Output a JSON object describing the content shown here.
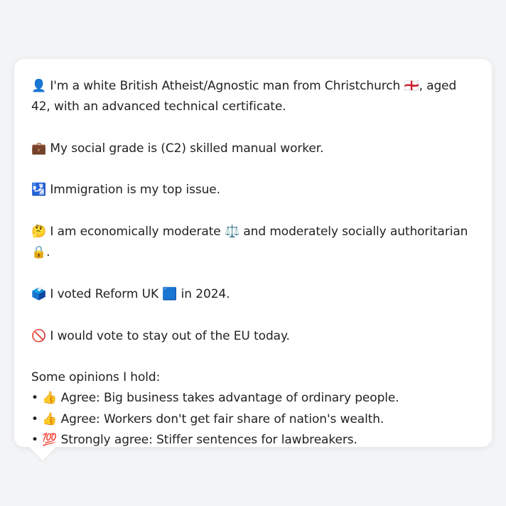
{
  "profile": {
    "identity": "👤 I'm a white British Atheist/Agnostic man from Christchurch 🏴󠁧󠁢󠁥󠁮󠁧󠁿, aged 42, with an advanced technical certificate.",
    "social_grade": "💼 My social grade is (C2) skilled manual worker.",
    "top_issue": "🛂 Immigration is my top issue.",
    "political_position": "🤔 I am economically moderate ⚖️ and moderately socially authoritarian 🔒.",
    "vote_2024": "🗳️ I voted Reform UK 🟦 in 2024.",
    "eu_vote": "🚫 I would vote to stay out of the EU today."
  },
  "opinions": {
    "title": "Some opinions I hold:",
    "items": [
      "• 👍 Agree: Big business takes advantage of ordinary people.",
      "• 👍 Agree: Workers don't get fair share of nation's wealth.",
      "• 💯 Strongly agree: Stiffer sentences for lawbreakers."
    ]
  }
}
